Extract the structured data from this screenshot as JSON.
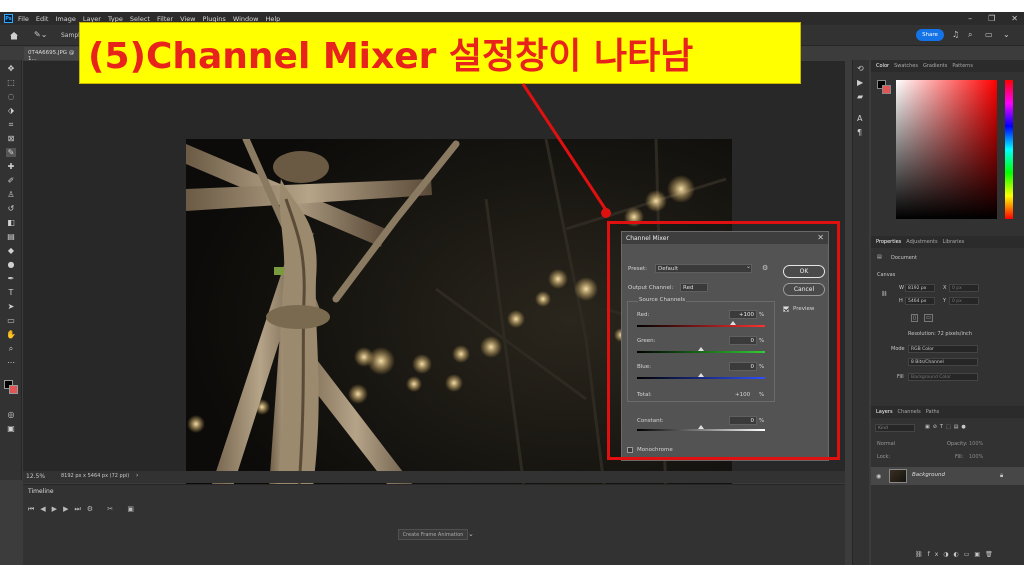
{
  "menubar": {
    "app_logo": "Ps",
    "items": [
      "File",
      "Edit",
      "Image",
      "Layer",
      "Type",
      "Select",
      "Filter",
      "View",
      "Plugins",
      "Window",
      "Help"
    ]
  },
  "optionsbar": {
    "sample_label": "Sample",
    "share_label": "Share"
  },
  "document_tab": {
    "title": "0T4A6695.JPG @ 1..."
  },
  "status_bar": {
    "zoom": "12.5%",
    "doc_info": "8192 px x 5464 px (72 ppi)"
  },
  "timeline": {
    "title": "Timeline",
    "create_button": "Create Frame Animation"
  },
  "color_panel": {
    "tabs": [
      "Color",
      "Swatches",
      "Gradients",
      "Patterns"
    ],
    "foreground_color": "#000000",
    "background_color": "#e05555"
  },
  "properties_panel": {
    "tabs": [
      "Properties",
      "Adjustments",
      "Libraries"
    ],
    "document_label": "Document",
    "canvas_label": "Canvas",
    "w_label": "W",
    "w_value": "8192 px",
    "x_label": "X",
    "x_value": "0 px",
    "h_label": "H",
    "h_value": "5464 px",
    "y_label": "Y",
    "y_value": "0 px",
    "resolution": "Resolution: 72 pixels/inch",
    "mode_label": "Mode",
    "mode_value": "RGB Color",
    "bit_depth": "8 Bits/Channel",
    "fill_label": "Fill",
    "fill_value": "Background Color"
  },
  "layers_panel": {
    "tabs": [
      "Layers",
      "Channels",
      "Paths"
    ],
    "kind_placeholder": "Kind",
    "blend_mode": "Normal",
    "opacity_label": "Opacity:",
    "opacity_value": "100%",
    "lock_label": "Lock:",
    "fill_label": "Fill:",
    "fill_value": "100%",
    "layer_name": "Background"
  },
  "dialog": {
    "title": "Channel Mixer",
    "preset_label": "Preset:",
    "preset_value": "Default",
    "output_label": "Output Channel:",
    "output_value": "Red",
    "source_label": "Source Channels",
    "red_label": "Red:",
    "red_value": "+100",
    "green_label": "Green:",
    "green_value": "0",
    "blue_label": "Blue:",
    "blue_value": "0",
    "total_label": "Total:",
    "total_value": "+100",
    "constant_label": "Constant:",
    "constant_value": "0",
    "percent": "%",
    "monochrome_label": "Monochrome",
    "ok_label": "OK",
    "cancel_label": "Cancel",
    "preview_label": "Preview",
    "red_level": 1.0,
    "green_level": 0.0,
    "blue_level": 0.0,
    "constant_level": 0.0
  },
  "annotation": {
    "banner_text": "(5)Channel Mixer 설정창이 나타남",
    "banner_bg": "#ffff00",
    "banner_color": "#e8231b",
    "highlight_color": "#e01010"
  }
}
